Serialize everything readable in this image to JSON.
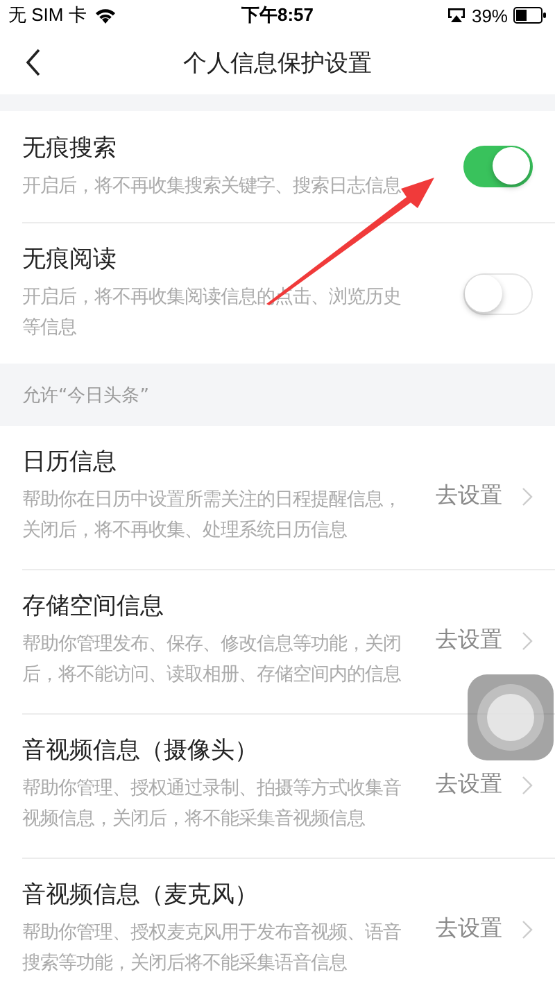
{
  "status_bar": {
    "carrier": "无 SIM 卡",
    "time": "下午8:57",
    "battery": "39%"
  },
  "nav": {
    "title": "个人信息保护设置"
  },
  "toggles": [
    {
      "title": "无痕搜索",
      "description": "开启后，将不再收集搜索关键字、搜索日志信息",
      "on": true
    },
    {
      "title": "无痕阅读",
      "description": "开启后，将不再收集阅读信息的点击、浏览历史等信息",
      "on": false
    }
  ],
  "section": {
    "label": "允许“今日头条”"
  },
  "permissions": [
    {
      "title": "日历信息",
      "description": "帮助你在日历中设置所需关注的日程提醒信息，关闭后，将不再收集、处理系统日历信息",
      "action": "去设置"
    },
    {
      "title": "存储空间信息",
      "description": "帮助你管理发布、保存、修改信息等功能，关闭后，将不能访问、读取相册、存储空间内的信息",
      "action": "去设置"
    },
    {
      "title": "音视频信息（摄像头）",
      "description": "帮助你管理、授权通过录制、拍摄等方式收集音视频信息，关闭后，将不能采集音视频信息",
      "action": "去设置"
    },
    {
      "title": "音视频信息（麦克风）",
      "description": "帮助你管理、授权麦克风用于发布音视频、语音搜索等功能，关闭后将不能采集语音信息",
      "action": "去设置"
    }
  ]
}
